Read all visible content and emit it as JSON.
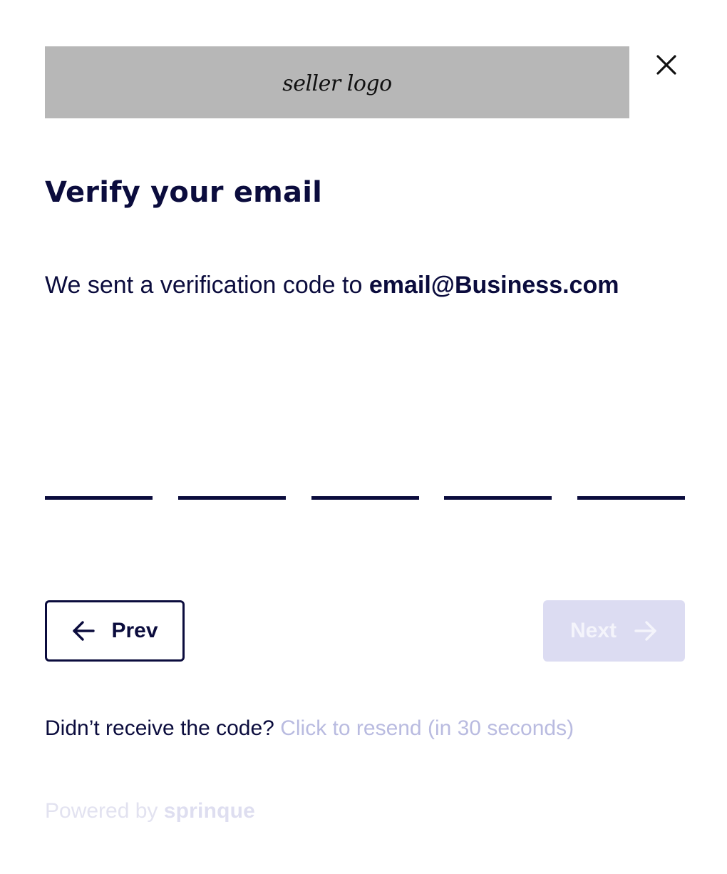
{
  "header": {
    "logo_text": "seller logo",
    "close_icon": "close-icon"
  },
  "main": {
    "title": "Verify your email",
    "subtitle_prefix": "We sent a verification code to ",
    "email": "email@Business.com",
    "code_inputs": [
      "",
      "",
      "",
      "",
      ""
    ]
  },
  "nav": {
    "prev_label": "Prev",
    "prev_icon": "arrow-left-icon",
    "next_label": "Next",
    "next_icon": "arrow-right-icon"
  },
  "resend": {
    "prompt": "Didn’t receive the code? ",
    "link": "Click to resend (in 30 seconds)"
  },
  "footer": {
    "powered_by": "Powered by ",
    "brand": "sprinque"
  },
  "colors": {
    "text_primary": "#0b0c3d",
    "logo_box": "#b7b7b7",
    "next_disabled_bg": "#dcdcf2",
    "link_muted": "#b9bbe0",
    "footer_muted": "#e2e2f0"
  }
}
